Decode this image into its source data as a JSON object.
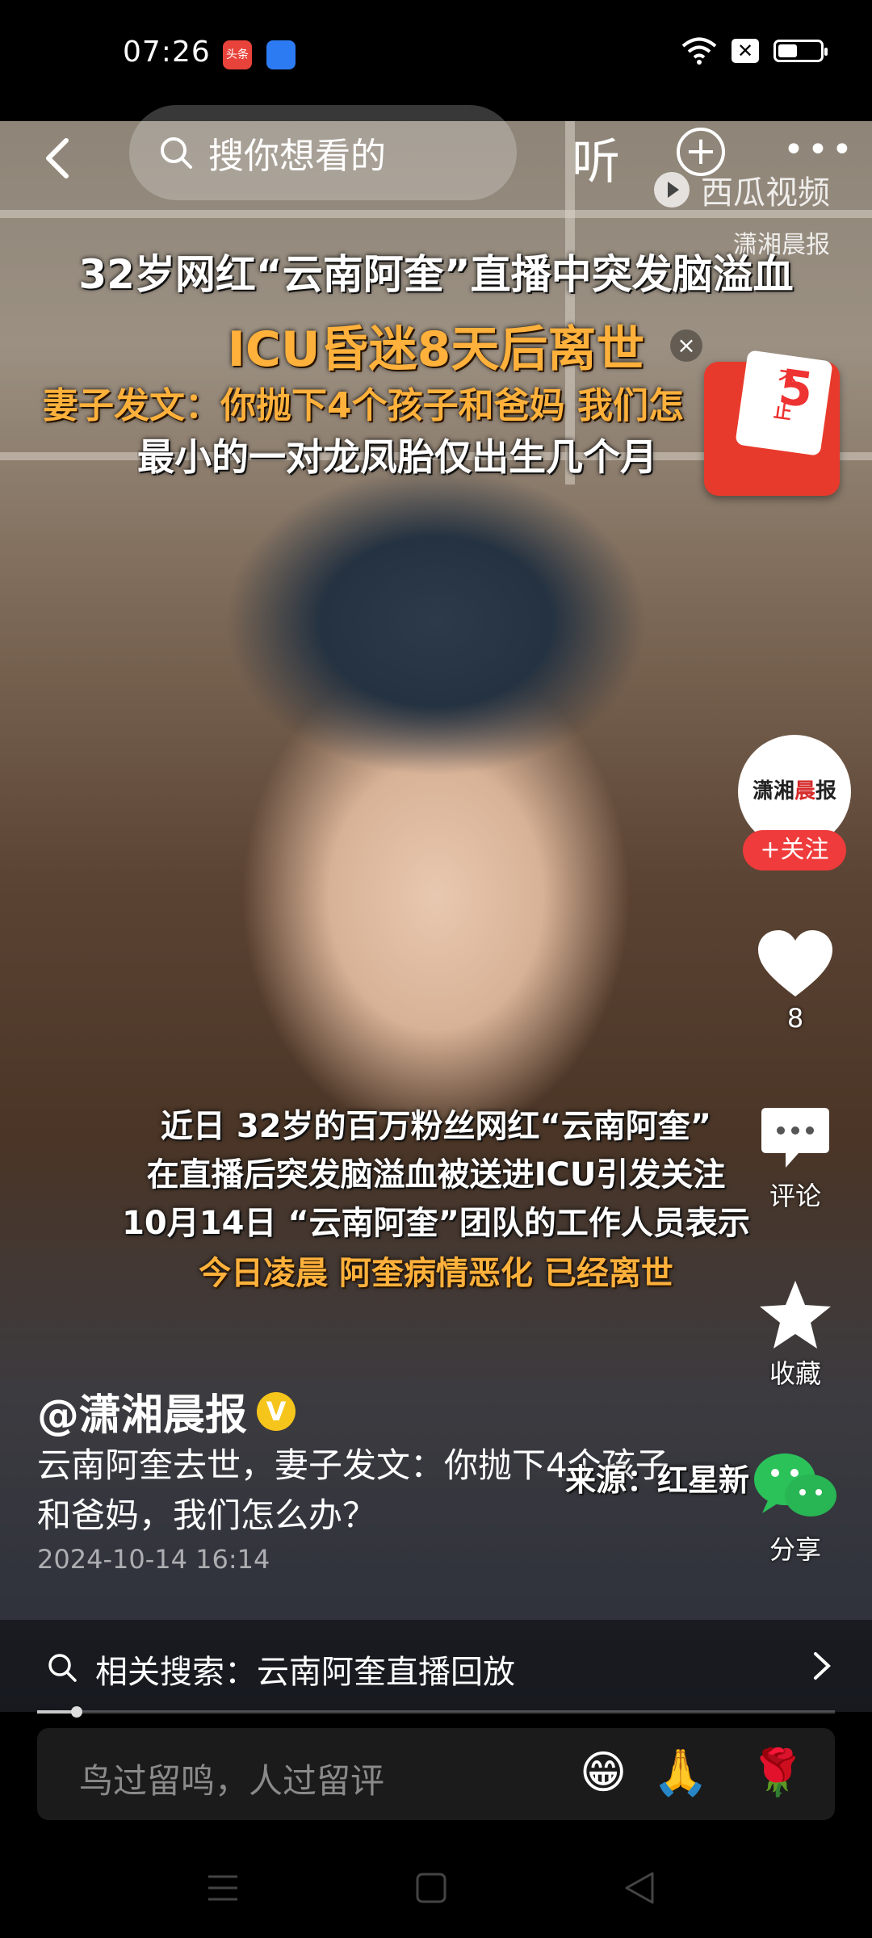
{
  "status_bar": {
    "time": "07:26",
    "app_icon_1": "头条",
    "battery_level": 0.45
  },
  "top_bar": {
    "search_placeholder": "搜你想看的",
    "listen_label": "听",
    "watermark": "西瓜视频",
    "source_mark": "潇湘晨报"
  },
  "captions": {
    "headline_1": "32岁网红“云南阿奎”直播中突发脑溢血",
    "headline_2": "ICU昏迷8天后离世",
    "headline_3": "妻子发文：你抛下4个孩子和爸妈 我们怎",
    "headline_4": "最小的一对龙凤胎仅出生几个月",
    "body_1": "近日 32岁的百万粉丝网红“云南阿奎”",
    "body_2": "在直播后突发脑溢血被送进ICU引发关注",
    "body_3": "10月14日 “云南阿奎”团队的工作人员表示",
    "body_4": "今日凌晨 阿奎病情恶化 已经离世"
  },
  "promo": {
    "line1": "不",
    "line2": "止",
    "number": "5"
  },
  "rail": {
    "avatar_text_1": "潇湘",
    "avatar_text_2": "晨",
    "avatar_text_3": "报",
    "follow_label": "+关注",
    "like_count": "8",
    "comment_label": "评论",
    "favorite_label": "收藏",
    "share_label": "分享"
  },
  "post": {
    "author": "@潇湘晨报",
    "verified_mark": "V",
    "description": "云南阿奎去世，妻子发文：你抛下4个孩子和爸妈，我们怎么办？",
    "overlay_source": "来源：红星新",
    "timestamp": "2024-10-14 16:14"
  },
  "related_search": {
    "text": "相关搜索：云南阿奎直播回放"
  },
  "playback": {
    "progress": 0.05
  },
  "comment_input": {
    "placeholder": "鸟过留鸣，人过留评",
    "emojis": [
      "😁",
      "🙏",
      "🌹"
    ]
  },
  "colors": {
    "follow_red": "#ef3b3b",
    "caption_orange": "#ffb13b",
    "verified_yellow": "#f6c51b"
  }
}
